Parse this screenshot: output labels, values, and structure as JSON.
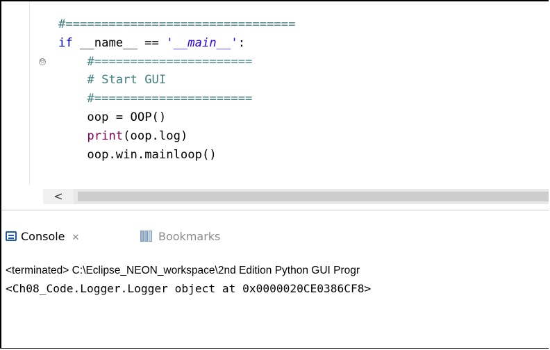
{
  "editor": {
    "fold_glyph": "⊖",
    "code_lines": [
      {
        "indent": "",
        "segments": [
          {
            "cls": "cm",
            "text": "#================================"
          }
        ]
      },
      {
        "indent": "",
        "segments": [
          {
            "cls": "kw",
            "text": "if"
          },
          {
            "cls": "op",
            "text": " __name__ == "
          },
          {
            "cls": "str",
            "text": "'__main__'"
          },
          {
            "cls": "op",
            "text": ":"
          }
        ]
      },
      {
        "indent": "    ",
        "segments": [
          {
            "cls": "cm",
            "text": "#======================"
          }
        ]
      },
      {
        "indent": "    ",
        "segments": [
          {
            "cls": "cm",
            "text": "# Start GUI"
          }
        ]
      },
      {
        "indent": "    ",
        "segments": [
          {
            "cls": "cm",
            "text": "#======================"
          }
        ]
      },
      {
        "indent": "    ",
        "segments": [
          {
            "cls": "op",
            "text": "oop = OOP()"
          }
        ]
      },
      {
        "indent": "    ",
        "segments": [
          {
            "cls": "fn",
            "text": "print"
          },
          {
            "cls": "op",
            "text": "(oop.log)"
          }
        ]
      },
      {
        "indent": "    ",
        "segments": [
          {
            "cls": "op",
            "text": "oop.win.mainloop()"
          }
        ]
      }
    ],
    "scroll_left_glyph": "<"
  },
  "console_view": {
    "tabs": {
      "console_label": "Console",
      "console_close_glyph": "✕",
      "bookmarks_label": "Bookmarks"
    },
    "status_text": "<terminated> C:\\Eclipse_NEON_workspace\\2nd Edition Python GUI Progr",
    "output_text": "<Ch08_Code.Logger.Logger object at 0x0000020CE0386CF8>"
  },
  "icons": {
    "console": "console-icon",
    "bookmarks": "bookmarks-icon",
    "fold": "fold-collapse-icon",
    "close": "close-icon",
    "scroll_left": "chevron-left-icon"
  },
  "colors": {
    "comment": "#3f7f7f",
    "keyword": "#0000c0",
    "string": "#2a00ff",
    "builtin": "#7f0055"
  }
}
